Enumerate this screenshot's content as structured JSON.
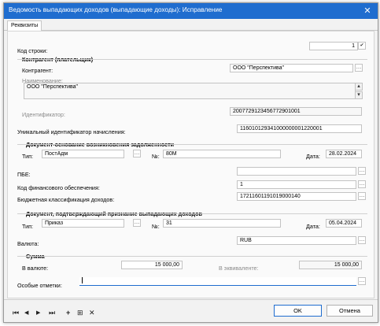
{
  "window": {
    "title": "Ведомость выпадающих доходов (выпадающие доходы): Исправление",
    "close_glyph": "✕"
  },
  "tabs": [
    {
      "label": "Реквизиты"
    }
  ],
  "row_code": {
    "label": "Код строки:",
    "value": "1",
    "check": "✔"
  },
  "counterparty": {
    "section": "Контрагент (плательщик)",
    "label": "Контрагент:",
    "value": "ООО \"Перспектива\"",
    "name_label": "Наименование:",
    "name_value": "ООО \"Перспектива\"",
    "id_label": "Идентификатор:",
    "id_value": "2007729123456772901001"
  },
  "uin": {
    "label": "Уникальный идентификатор начисления:",
    "value": "116010129341000000001220001"
  },
  "basis_doc": {
    "section": "Документ-основание возникновения задолженности",
    "type_label": "Тип:",
    "type_value": "ПостАдм",
    "num_label": "№:",
    "num_value": "80М",
    "date_label": "Дата:",
    "date_value": "28.02.2024"
  },
  "pbe": {
    "label": "ПБЕ:",
    "value": ""
  },
  "fin_code": {
    "label": "Код финансового обеспечения:",
    "value": "1"
  },
  "budget_class": {
    "label": "Бюджетная классификация доходов:",
    "value": "17211601191019000140"
  },
  "confirm_doc": {
    "section": "Документ, подтверждающий признание выпадающих доходов",
    "type_label": "Тип:",
    "type_value": "Приказ",
    "num_label": "№:",
    "num_value": "31",
    "date_label": "Дата:",
    "date_value": "05.04.2024"
  },
  "currency": {
    "label": "Валюта:",
    "value": "RUB"
  },
  "sum": {
    "section": "Сумма",
    "in_currency_label": "В валюте:",
    "in_currency_value": "15 000,00",
    "equiv_label": "В эквиваленте:",
    "equiv_value": "15 000,00"
  },
  "notes": {
    "label": "Особые отметки:",
    "value": ""
  },
  "footer": {
    "ok": "OK",
    "cancel": "Отмена",
    "nav_glyphs": [
      "⏮",
      "◀",
      "▶",
      "⏭",
      "+",
      "⊞",
      "✕"
    ]
  },
  "colors": {
    "titlebar": "#1f6dcf",
    "focus": "#1f6dcf"
  }
}
